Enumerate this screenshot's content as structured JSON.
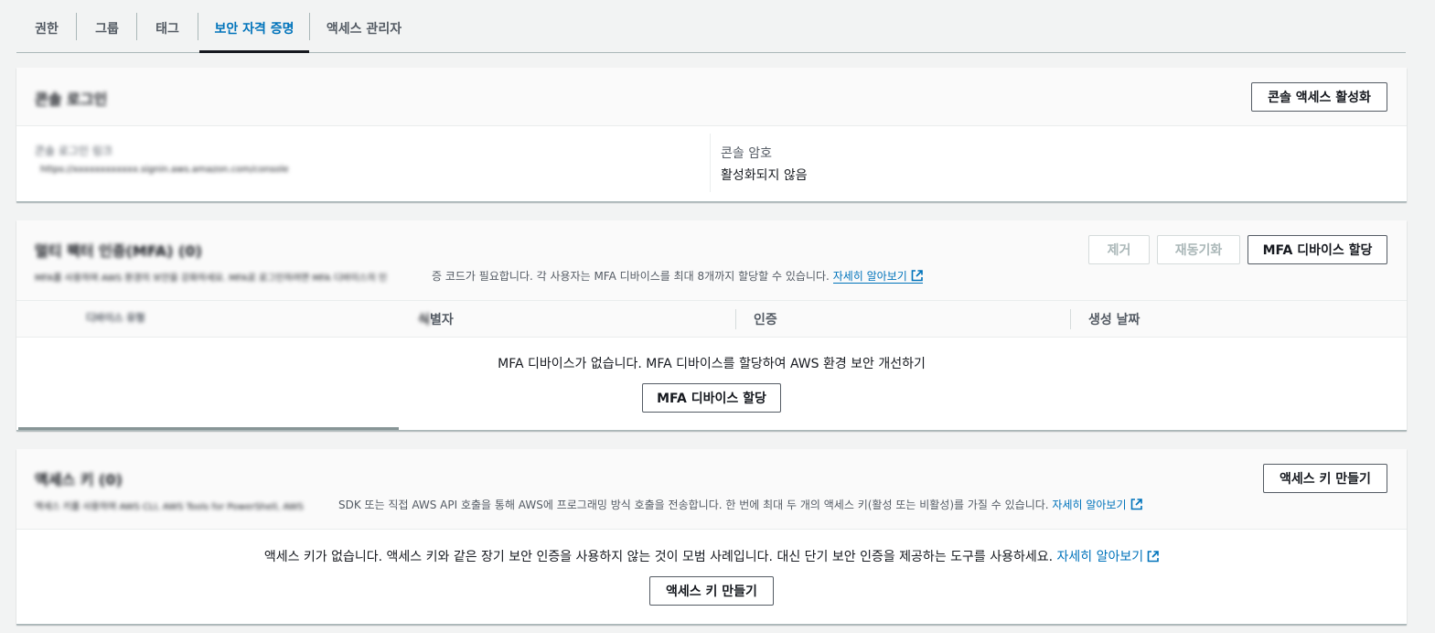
{
  "tabs": [
    {
      "label": "권한"
    },
    {
      "label": "그룹"
    },
    {
      "label": "태그"
    },
    {
      "label": "보안 자격 증명"
    },
    {
      "label": "액세스 관리자"
    }
  ],
  "active_tab": "보안 자격 증명",
  "console_signin": {
    "title": "콘솔 로그인",
    "enable_button": "콘솔 액세스 활성화",
    "signin_link_label": "콘솔 로그인 링크",
    "signin_link_value": "https://xxxxxxxxxxxx.signin.aws.amazon.com/console",
    "password_label": "콘솔 암호",
    "password_value": "활성화되지 않음"
  },
  "mfa": {
    "title": "멀티 팩터 인증(MFA) (0)",
    "description_prefix": "MFA를 사용하여 AWS 환경의 보안을 강화하세요. MFA로 로그인하려면 MFA 디바이스의 인",
    "description": "증 코드가 필요합니다. 각 사용자는 MFA 디바이스를 최대 8개까지 할당할 수 있습니다.",
    "learn_more": "자세히 알아보기",
    "remove_button": "제거",
    "resync_button": "재동기화",
    "assign_button": "MFA 디바이스 할당",
    "columns": [
      "디바이스 유형",
      "식별자",
      "인증",
      "생성 날짜"
    ],
    "empty_message": "MFA 디바이스가 없습니다. MFA 디바이스를 할당하여 AWS 환경 보안 개선하기",
    "empty_assign_button": "MFA 디바이스 할당"
  },
  "access_keys": {
    "title": "액세스 키 (0)",
    "description_prefix": "액세스 키를 사용하여 AWS CLI, AWS Tools for PowerShell, AWS ",
    "description": "SDK 또는 직접 AWS API 호출을 통해 AWS에 프로그래밍 방식 호출을 전송합니다. 한 번에 최대 두 개의 액세스 키(활성 또는 비활성)를 가질 수 있습니다.",
    "learn_more": "자세히 알아보기",
    "create_button": "액세스 키 만들기",
    "empty_message": "액세스 키가 없습니다. 액세스 키와 같은 장기 보안 인증을 사용하지 않는 것이 모범 사례입니다. 대신 단기 보안 인증을 제공하는 도구를 사용하세요.",
    "empty_learn_more": "자세히 알아보기",
    "empty_create_button": "액세스 키 만들기"
  },
  "colors": {
    "link": "#0073bb",
    "text": "#16191f",
    "muted": "#545b64",
    "border": "#aab7b8"
  },
  "icons": [
    "external-link-icon"
  ]
}
